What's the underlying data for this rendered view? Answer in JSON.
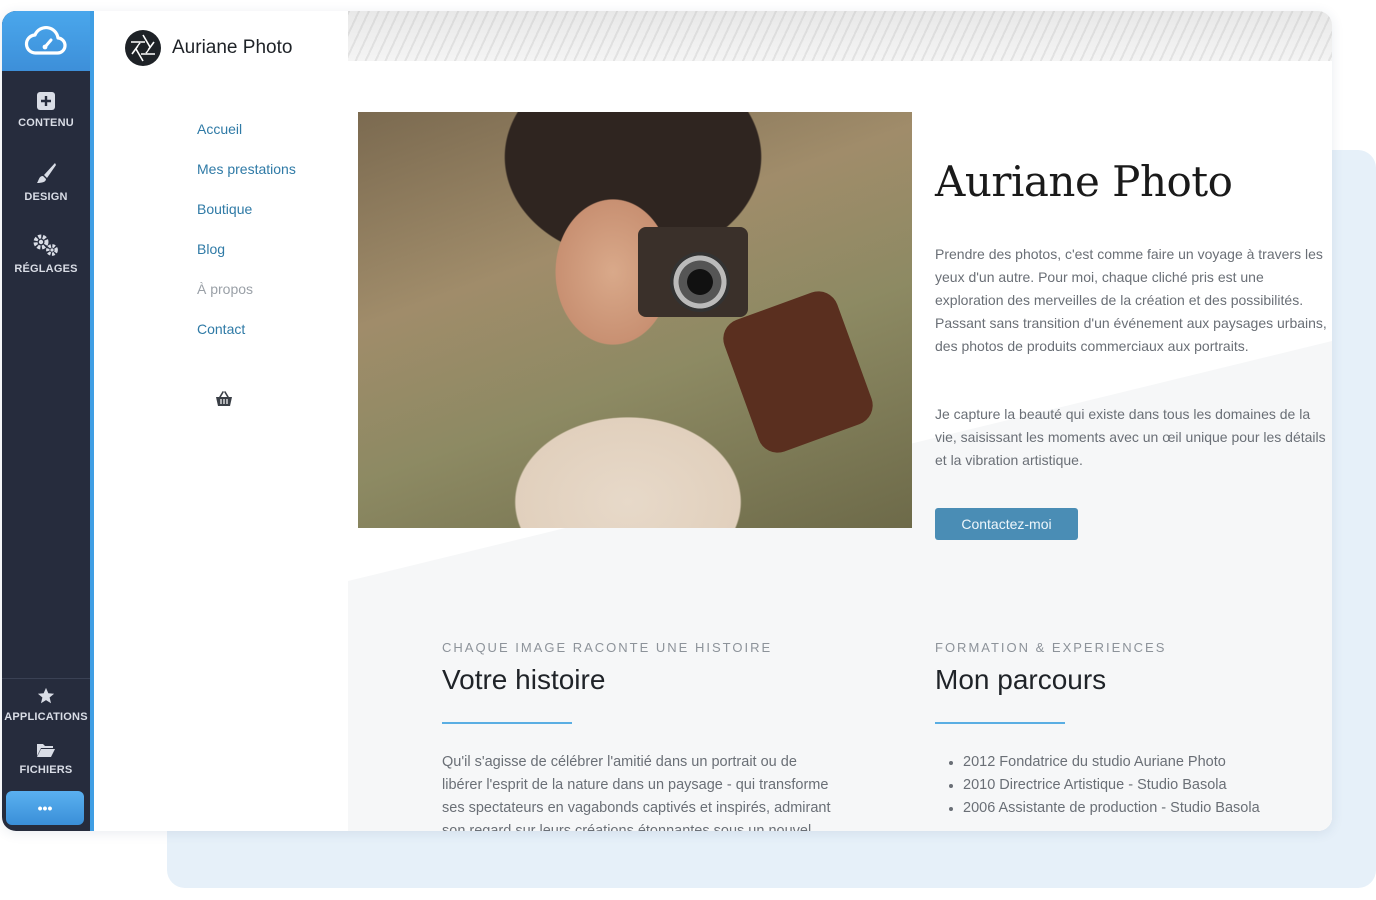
{
  "editor": {
    "tools": [
      {
        "label": "CONTENU",
        "icon": "plus-square-icon"
      },
      {
        "label": "DESIGN",
        "icon": "brush-icon"
      },
      {
        "label": "RÉGLAGES",
        "icon": "gears-icon"
      }
    ],
    "bottom_tools": [
      {
        "label": "APPLICATIONS",
        "icon": "star-icon"
      },
      {
        "label": "FICHIERS",
        "icon": "folder-icon"
      }
    ],
    "more_label": "•••",
    "logo_icon": "cloud-icon",
    "accent_color": "#3f9ee4",
    "sidebar_color": "#262c3d"
  },
  "site": {
    "name": "Auriane Photo",
    "logo_icon": "aperture-icon",
    "nav": [
      "Accueil",
      "Mes prestations",
      "Boutique",
      "Blog",
      "À propos",
      "Contact"
    ],
    "cart_icon": "basket-icon"
  },
  "hero": {
    "title": "Auriane Photo",
    "paragraph1": "Prendre des photos, c'est comme faire un voyage à travers les yeux d'un autre. Pour moi, chaque cliché pris est une exploration des merveilles de la création et des possibilités. Passant sans transition d'un événement aux paysages urbains, des photos de produits commerciaux aux portraits.",
    "paragraph2": "Je capture la beauté qui existe dans tous les domaines de la vie, saisissant les moments avec un œil unique pour les détails et la vibration artistique.",
    "cta": "Contactez-moi",
    "cta_color": "#4a8db5"
  },
  "story": {
    "kicker": "CHAQUE IMAGE RACONTE UNE HISTOIRE",
    "title": "Votre histoire",
    "body": "Qu'il s'agisse de célébrer l'amitié dans un portrait ou de libérer l'esprit de la nature dans un paysage - qui transforme ses spectateurs en vagabonds captivés et inspirés, admirant son regard sur leurs créations étonnantes sous un nouvel"
  },
  "career": {
    "kicker": "FORMATION & EXPERIENCES",
    "title": "Mon parcours",
    "items": [
      "2012 Fondatrice du studio Auriane Photo",
      "2010 Directrice Artistique - Studio Basola",
      "2006 Assistante de production - Studio Basola"
    ]
  }
}
